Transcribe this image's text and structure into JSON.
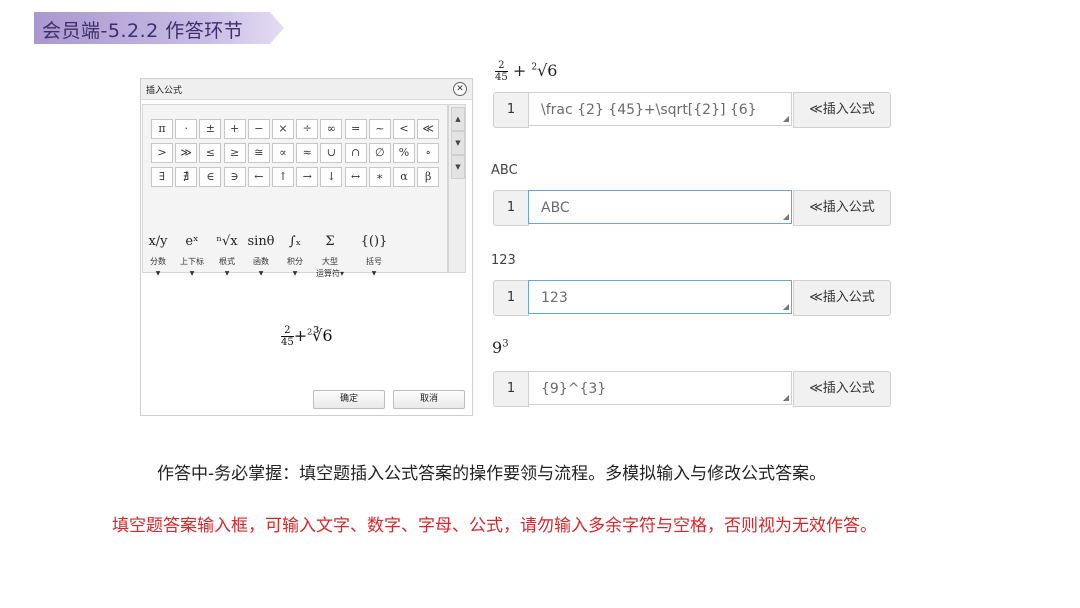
{
  "banner": {
    "title": "会员端-5.2.2  作答环节"
  },
  "dialog": {
    "title": "插入公式",
    "close_glyph": "✕",
    "symbols": [
      [
        "π",
        "·",
        "±",
        "+",
        "−",
        "×",
        "÷",
        "∞",
        "=",
        "~",
        "<",
        "≪"
      ],
      [
        ">",
        "≫",
        "≤",
        "≥",
        "≅",
        "∝",
        "≈",
        "∪",
        "∩",
        "∅",
        "%",
        "∘"
      ],
      [
        "∃",
        "∄",
        "∈",
        "∋",
        "←",
        "↑",
        "→",
        "↓",
        "↔",
        "∗",
        "α",
        "β"
      ]
    ],
    "categories": [
      {
        "icon": "x/y",
        "label": "分数"
      },
      {
        "icon": "eˣ",
        "label": "上下标"
      },
      {
        "icon": "ⁿ√x",
        "label": "根式"
      },
      {
        "icon": "sinθ",
        "label": "函数"
      },
      {
        "icon": "∫ₓ",
        "label": "积分"
      },
      {
        "icon": "Σ",
        "label": "大型"
      },
      {
        "icon": "{()}",
        "label": "括号"
      }
    ],
    "operator_label": "运算符▾",
    "preview": {
      "num": "2",
      "den": "45",
      "plus": "+",
      "root": "∛6",
      "root_index": "2"
    },
    "ok_label": "确定",
    "cancel_label": "取消"
  },
  "answers": {
    "formula1": {
      "num": "2",
      "den": "45",
      "plus": "+",
      "root_index": "2",
      "root": "√6"
    },
    "rows": [
      {
        "index": "1",
        "value": "\\frac {2} {45}+\\sqrt[{2}] {6}",
        "insert": "≪插入公式"
      },
      {
        "index": "1",
        "value": "ABC",
        "insert": "≪插入公式"
      },
      {
        "index": "1",
        "value": "123",
        "insert": "≪插入公式"
      },
      {
        "index": "1",
        "value": "{9}^{3}",
        "insert": "≪插入公式"
      }
    ],
    "label2": "ABC",
    "label3": "123",
    "formula4": {
      "base": "9",
      "exp": "3"
    }
  },
  "notes": {
    "line1": "作答中-务必掌握：填空题插入公式答案的操作要领与流程。多模拟输入与修改公式答案。",
    "line2": "填空题答案输入框，可输入文字、数字、字母、公式，请勿输入多余字符与空格，否则视为无效作答。"
  }
}
